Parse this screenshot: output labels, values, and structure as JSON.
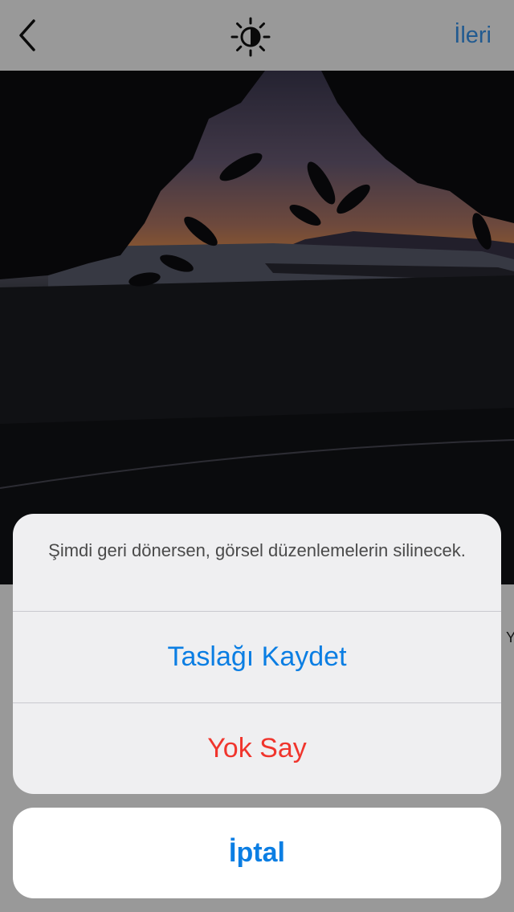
{
  "header": {
    "back_icon": "chevron-left-icon",
    "lux_icon": "sun-half-icon",
    "next_label": "İleri"
  },
  "tools": {
    "partial_letter": "Y"
  },
  "action_sheet": {
    "message": "Şimdi geri dönersen, görsel düzenlemelerin silinecek.",
    "save_draft_label": "Taslağı Kaydet",
    "discard_label": "Yok Say",
    "cancel_label": "İptal"
  },
  "colors": {
    "accent": "#0b7ee3",
    "destructive": "#f0352d",
    "next": "#3897f0"
  }
}
